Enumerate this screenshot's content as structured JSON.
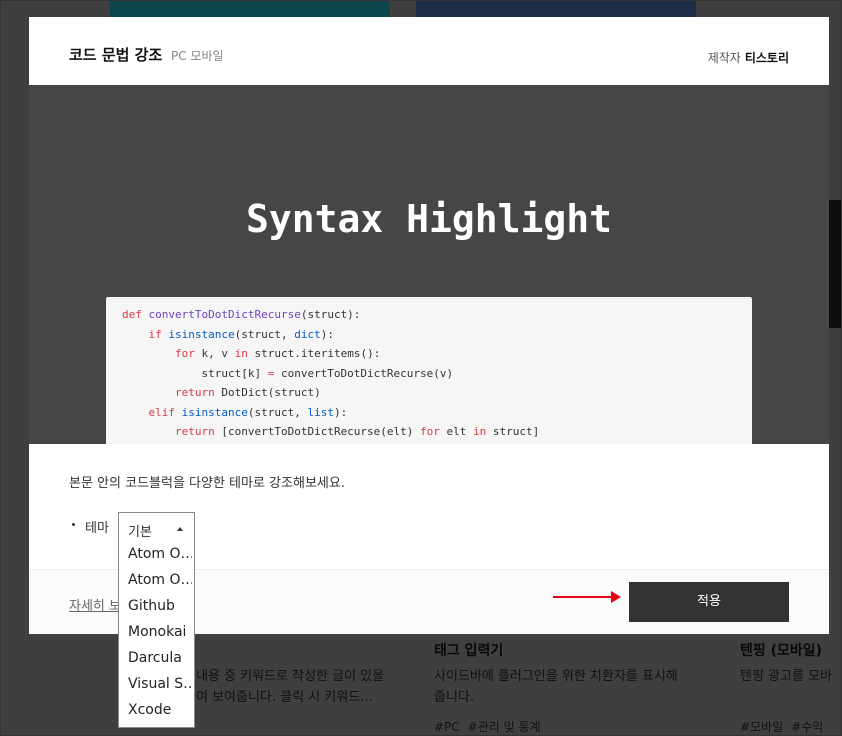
{
  "modal": {
    "title": "코드 문법 강조",
    "platform": "PC 모바일",
    "maker_label": "제작자",
    "maker_name": "티스토리",
    "preview_title": "Syntax Highlight",
    "description": "본문 안의 코드블럭을 다양한 테마로 강조해보세요.",
    "theme_label": "테마",
    "more_link": "자세히 보",
    "apply_label": "적용"
  },
  "code_lines": [
    "def convertToDotDictRecurse(struct):",
    "    if isinstance(struct, dict):",
    "        for k, v in struct.iteritems():",
    "            struct[k] = convertToDotDictRecurse(v)",
    "        return DotDict(struct)",
    "    elif isinstance(struct, list):",
    "        return [convertToDotDictRecurse(elt) for elt in struct]"
  ],
  "theme_select": {
    "selected": "기본",
    "options": [
      "Atom O…",
      "Atom O…",
      "Github",
      "Monokai",
      "Darcula",
      "Visual S…",
      "Xcode"
    ]
  },
  "background": {
    "card1": {
      "title": "력",
      "desc_line1": "내용 중 키워드로 작성한 글이 있을",
      "desc_line2": "여 보여줍니다. 클릭 시 키워드…"
    },
    "card2": {
      "title": "태그 입력기",
      "desc_line1": "사이드바에 플러그인을 위한 치환자를 표시해",
      "desc_line2": "줍니다.",
      "tags": [
        "#PC",
        "#관리 및 통계"
      ]
    },
    "card3": {
      "title": "텐핑 (모바일)",
      "desc_line1": "텐핑 광고를 모바",
      "tags": [
        "#모바일",
        "#수익"
      ]
    }
  },
  "colors": {
    "apply_bg": "#333333",
    "arrow": "#e60012"
  }
}
